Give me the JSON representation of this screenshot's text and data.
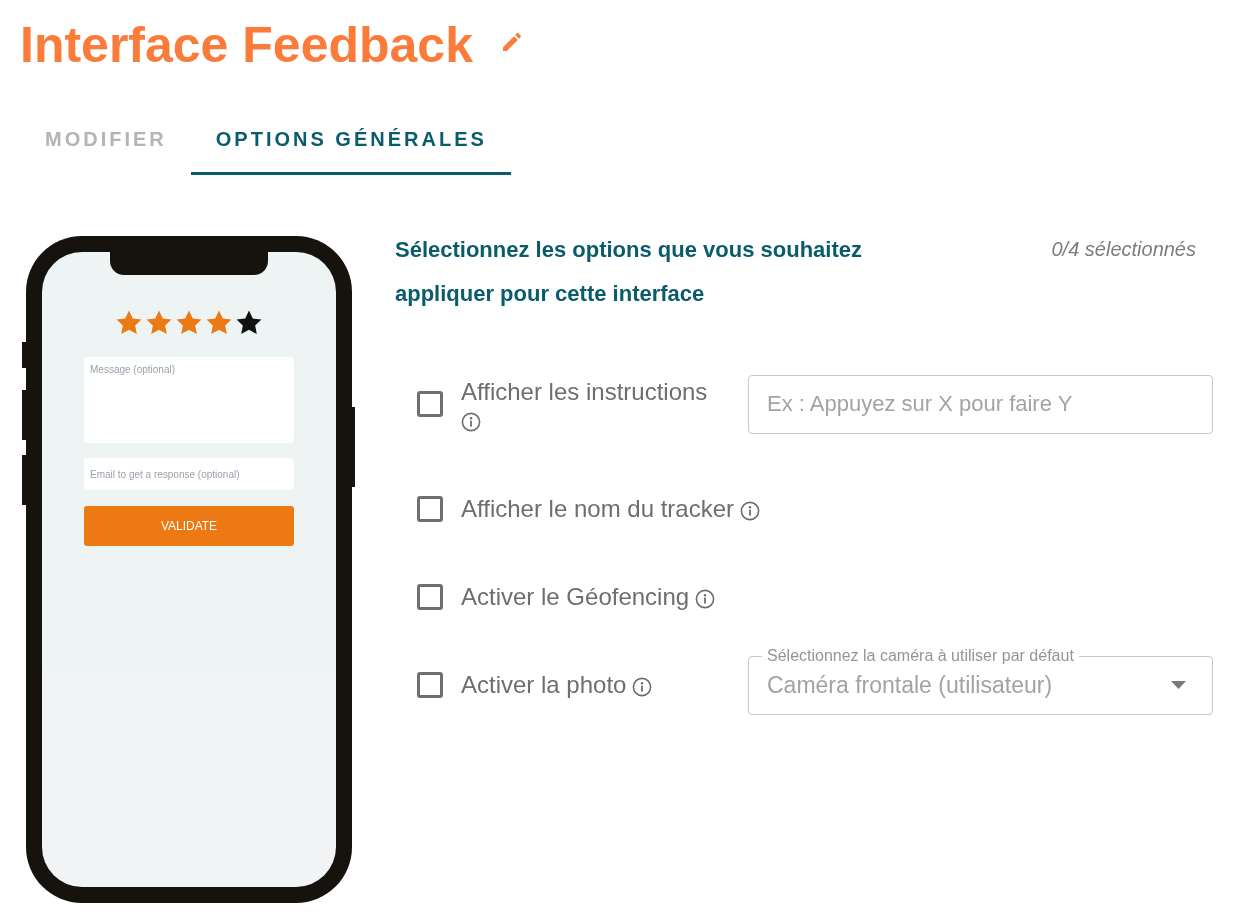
{
  "title": "Interface Feedback",
  "tabs": [
    {
      "label": "MODIFIER",
      "selected": false
    },
    {
      "label": "OPTIONS GÉNÉRALES",
      "selected": true
    }
  ],
  "preview": {
    "stars": 4,
    "message_placeholder": "Message (optional)",
    "email_placeholder": "Email to get a response (optional)",
    "button": "VALIDATE"
  },
  "options_panel": {
    "heading": "Sélectionnez les options que vous souhaitez appliquer pour cette interface",
    "counter": "0/4 sélectionnés",
    "options": [
      {
        "kind": "text-field",
        "label": "Afficher les instructions",
        "checked": false,
        "field": {
          "placeholder": "Ex : Appuyez sur X pour faire Y"
        }
      },
      {
        "kind": "plain",
        "label": "Afficher le nom du tracker",
        "checked": false
      },
      {
        "kind": "plain",
        "label": "Activer le Géofencing",
        "checked": false
      },
      {
        "kind": "select",
        "label": "Activer la photo",
        "checked": false,
        "field": {
          "label": "Sélectionnez la caméra à utiliser par défaut",
          "value": "Caméra frontale (utilisateur)",
          "disabled": true
        }
      }
    ]
  }
}
